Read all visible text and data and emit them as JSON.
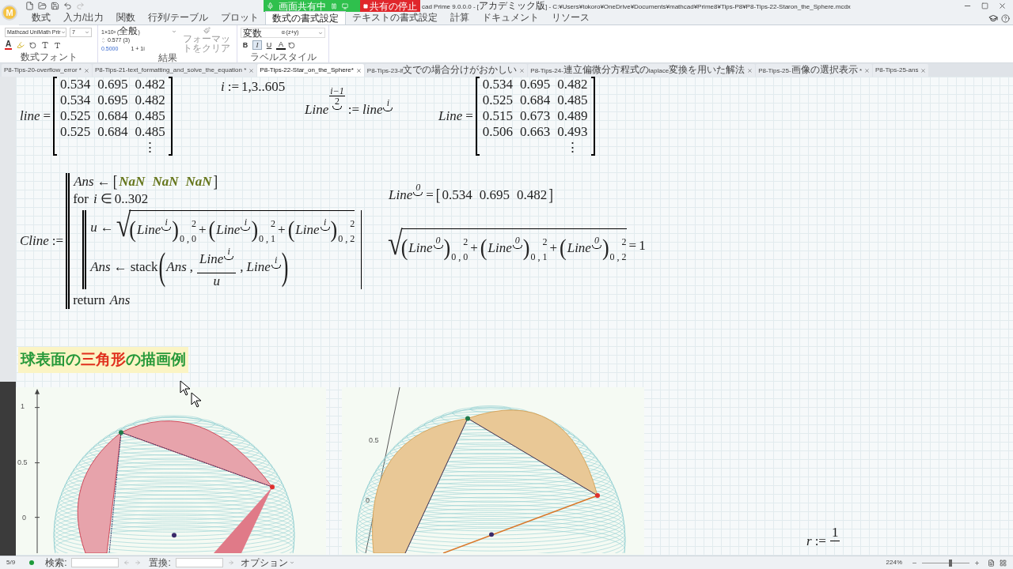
{
  "title_bar": {
    "logo": "M",
    "sharing_label": "画面共有中",
    "stop_button": "共有の停止",
    "title": "cad Prime 9.0.0.0 - [アカデミック版] - C:¥Users¥tokoro¥OneDrive¥Documents¥mathcad¥Prime8¥Tips-P8¥P8-Tips-22-Staron_the_Sphere.mcdx"
  },
  "ribbon_tabs": [
    {
      "label": "数式",
      "selected": false
    },
    {
      "label": "入力/出力",
      "selected": false
    },
    {
      "label": "関数",
      "selected": false
    },
    {
      "label": "行列/テーブル",
      "selected": false
    },
    {
      "label": "プロット",
      "selected": false
    },
    {
      "label": "数式の書式設定",
      "selected": true
    },
    {
      "label": "テキストの書式設定",
      "selected": false
    },
    {
      "label": "計算",
      "selected": false
    },
    {
      "label": "ドキュメント",
      "selected": false
    },
    {
      "label": "リソース",
      "selected": false
    }
  ],
  "ribbon": {
    "font_select": "Mathcad UniMath Prir",
    "size_select": "7",
    "font_color_button": "A",
    "result_format": "1×10³ (全般)",
    "precision": "0.577 (3)",
    "tolerance": "0.5000",
    "complex_format": "1 + 1i",
    "clear_format_button": {
      "label": "フォーマットをクリア",
      "disabled": true
    },
    "label_style": "変数",
    "label_example": "α∙(z+y)",
    "style_buttons": [
      {
        "label": "B",
        "kind": "bold",
        "selected": false
      },
      {
        "label": "I",
        "kind": "italic",
        "selected": true
      },
      {
        "label": "U",
        "kind": "underline",
        "selected": false
      },
      {
        "label": "A",
        "kind": "color",
        "selected": false
      }
    ],
    "group_labels": [
      "数式フォント",
      "結果",
      "ラベルスタイル"
    ]
  },
  "doc_tabs": [
    {
      "label": "P8-Tips-20-overflow_error *",
      "selected": false
    },
    {
      "label": "P8-Tips-21-text_formatting_and_solve_the_equation *",
      "selected": false
    },
    {
      "label": "P8-Tips-22-Star_on_the_Sphere*",
      "selected": true
    },
    {
      "label": "P8-Tips-23-if文での場合分けがおかしい",
      "selected": false
    },
    {
      "label": "P8-Tips-24-連立偏微分方程式のlaplace変換を用いた解法",
      "selected": false
    },
    {
      "label": "P8-Tips-25-画像の選択表示 *",
      "selected": false
    },
    {
      "label": "P8-Tips-25-ans",
      "selected": false
    }
  ],
  "worksheet": {
    "regions": [
      {
        "kind": "math",
        "tokens": [
          {
            "kind": "var",
            "text": "line"
          },
          {
            "kind": "op",
            "text": "="
          },
          {
            "kind": "matrix",
            "rows": [
              [
                "0.534",
                "0.695",
                "0.482"
              ],
              [
                "0.534",
                "0.695",
                "0.482"
              ],
              [
                "0.525",
                "0.684",
                "0.485"
              ],
              [
                "0.525",
                "0.684",
                "0.485"
              ]
            ],
            "more": "⋮"
          }
        ]
      },
      {
        "kind": "math",
        "tokens": [
          {
            "kind": "var",
            "text": "i"
          },
          {
            "kind": "op",
            "text": ":="
          },
          {
            "kind": "num",
            "text": "1,3..605"
          }
        ]
      },
      {
        "kind": "math",
        "tokens": [
          {
            "kind": "col",
            "text": "Line",
            "index_num": "i−1",
            "index_den": "2"
          },
          {
            "kind": "op",
            "text": ":="
          },
          {
            "kind": "col",
            "text": "line",
            "index": "i"
          }
        ]
      },
      {
        "kind": "math",
        "tokens": [
          {
            "kind": "var",
            "text": "Line"
          },
          {
            "kind": "op",
            "text": "="
          },
          {
            "kind": "matrix",
            "rows": [
              [
                "0.534",
                "0.695",
                "0.482"
              ],
              [
                "0.525",
                "0.684",
                "0.485"
              ],
              [
                "0.515",
                "0.673",
                "0.489"
              ],
              [
                "0.506",
                "0.663",
                "0.493"
              ]
            ],
            "more": "⋮"
          }
        ]
      },
      {
        "kind": "math",
        "tokens": [
          {
            "kind": "var",
            "text": "Cline"
          },
          {
            "kind": "op",
            "text": ":="
          },
          {
            "kind": "program",
            "lines": [
              {
                "tokens": [
                  {
                    "kind": "var",
                    "text": "Ans"
                  },
                  {
                    "kind": "op",
                    "text": "←"
                  },
                  {
                    "kind": "row",
                    "open": "[",
                    "close": "]",
                    "items": [
                      {
                        "kind": "const",
                        "text": "NaN"
                      },
                      {
                        "kind": "const",
                        "text": "NaN"
                      },
                      {
                        "kind": "const",
                        "text": "NaN"
                      }
                    ]
                  }
                ]
              },
              {
                "tokens": [
                  {
                    "kind": "kw",
                    "text": "for"
                  },
                  {
                    "kind": "var",
                    "text": "i"
                  },
                  {
                    "kind": "op",
                    "text": "∈"
                  },
                  {
                    "kind": "num",
                    "text": "0..302"
                  }
                ]
              },
              {
                "block": [
                  {
                    "tokens": [
                      {
                        "kind": "var",
                        "text": "u"
                      },
                      {
                        "kind": "op",
                        "text": "←"
                      },
                      {
                        "kind": "sqrt",
                        "sign": "√",
                        "body": [
                          {
                            "kind": "paren",
                            "open": "(",
                            "close": ")",
                            "body": [
                              {
                                "kind": "col",
                                "text": "Line",
                                "index": "i"
                              }
                            ],
                            "sub": "0 , 0",
                            "sup": "2"
                          },
                          {
                            "kind": "op",
                            "text": "+"
                          },
                          {
                            "kind": "paren",
                            "open": "(",
                            "close": ")",
                            "body": [
                              {
                                "kind": "col",
                                "text": "Line",
                                "index": "i"
                              }
                            ],
                            "sub": "0 , 1",
                            "sup": "2"
                          },
                          {
                            "kind": "op",
                            "text": "+"
                          },
                          {
                            "kind": "paren",
                            "open": "(",
                            "close": ")",
                            "body": [
                              {
                                "kind": "col",
                                "text": "Line",
                                "index": "i"
                              }
                            ],
                            "sub": "0 , 2",
                            "sup": "2"
                          }
                        ]
                      }
                    ]
                  },
                  {
                    "tokens": [
                      {
                        "kind": "var",
                        "text": "Ans"
                      },
                      {
                        "kind": "op",
                        "text": "←"
                      },
                      {
                        "kind": "func",
                        "text": "stack"
                      },
                      {
                        "kind": "paren",
                        "open": "(",
                        "close": ")",
                        "body": [
                          {
                            "kind": "var",
                            "text": "Ans"
                          },
                          {
                            "kind": "op",
                            "text": ","
                          },
                          {
                            "kind": "frac",
                            "num": [
                              {
                                "kind": "col",
                                "text": "Line",
                                "index": "i"
                              }
                            ],
                            "den": [
                              {
                                "kind": "var",
                                "text": "u"
                              }
                            ]
                          },
                          {
                            "kind": "op",
                            "text": ","
                          },
                          {
                            "kind": "col",
                            "text": "Line",
                            "index": "i"
                          }
                        ]
                      }
                    ]
                  }
                ]
              },
              {
                "tokens": [
                  {
                    "kind": "kw",
                    "text": "return"
                  },
                  {
                    "kind": "var",
                    "text": "Ans"
                  }
                ]
              }
            ]
          }
        ]
      },
      {
        "kind": "math",
        "tokens": [
          {
            "kind": "col",
            "text": "Line",
            "index": "0"
          },
          {
            "kind": "op",
            "text": "="
          },
          {
            "kind": "row",
            "open": "[",
            "close": "]",
            "items": [
              {
                "kind": "num",
                "text": "0.534"
              },
              {
                "kind": "num",
                "text": "0.695"
              },
              {
                "kind": "num",
                "text": "0.482"
              }
            ]
          }
        ]
      },
      {
        "kind": "math",
        "tokens": [
          {
            "kind": "sqrt",
            "sign": "√",
            "body": [
              {
                "kind": "paren",
                "open": "(",
                "close": ")",
                "body": [
                  {
                    "kind": "col",
                    "text": "Line",
                    "index": "0"
                  }
                ],
                "sub": "0 , 0",
                "sup": "2"
              },
              {
                "kind": "op",
                "text": "+"
              },
              {
                "kind": "paren",
                "open": "(",
                "close": ")",
                "body": [
                  {
                    "kind": "col",
                    "text": "Line",
                    "index": "0"
                  }
                ],
                "sub": "0 , 1",
                "sup": "2"
              },
              {
                "kind": "op",
                "text": "+"
              },
              {
                "kind": "paren",
                "open": "(",
                "close": ")",
                "body": [
                  {
                    "kind": "col",
                    "text": "Line",
                    "index": "0"
                  }
                ],
                "sub": "0 , 2",
                "sup": "2"
              }
            ]
          },
          {
            "kind": "op",
            "text": "="
          },
          {
            "kind": "num",
            "text": "1"
          }
        ]
      },
      {
        "kind": "heading",
        "parts": [
          {
            "text": "球表面の",
            "color": "#27993a"
          },
          {
            "text": "三角形",
            "color": "#e0301e"
          },
          {
            "text": "の描画例",
            "color": "#27993a"
          }
        ]
      },
      {
        "kind": "plot",
        "ticks": [
          "1",
          "0.5",
          "0"
        ]
      },
      {
        "kind": "plot",
        "ticks": [
          "0.5",
          "0"
        ]
      },
      {
        "kind": "math",
        "tokens": [
          {
            "kind": "var",
            "text": "r"
          },
          {
            "kind": "op",
            "text": ":="
          },
          {
            "kind": "frac",
            "num": [
              {
                "kind": "num",
                "text": "1"
              }
            ]
          }
        ]
      }
    ]
  },
  "status_bar": {
    "page": "5/9",
    "find_label": "検索:",
    "replace_label": "置換:",
    "options_button": "オプション",
    "zoom": "224%",
    "zoom_slider": {
      "level": 0.6
    }
  }
}
